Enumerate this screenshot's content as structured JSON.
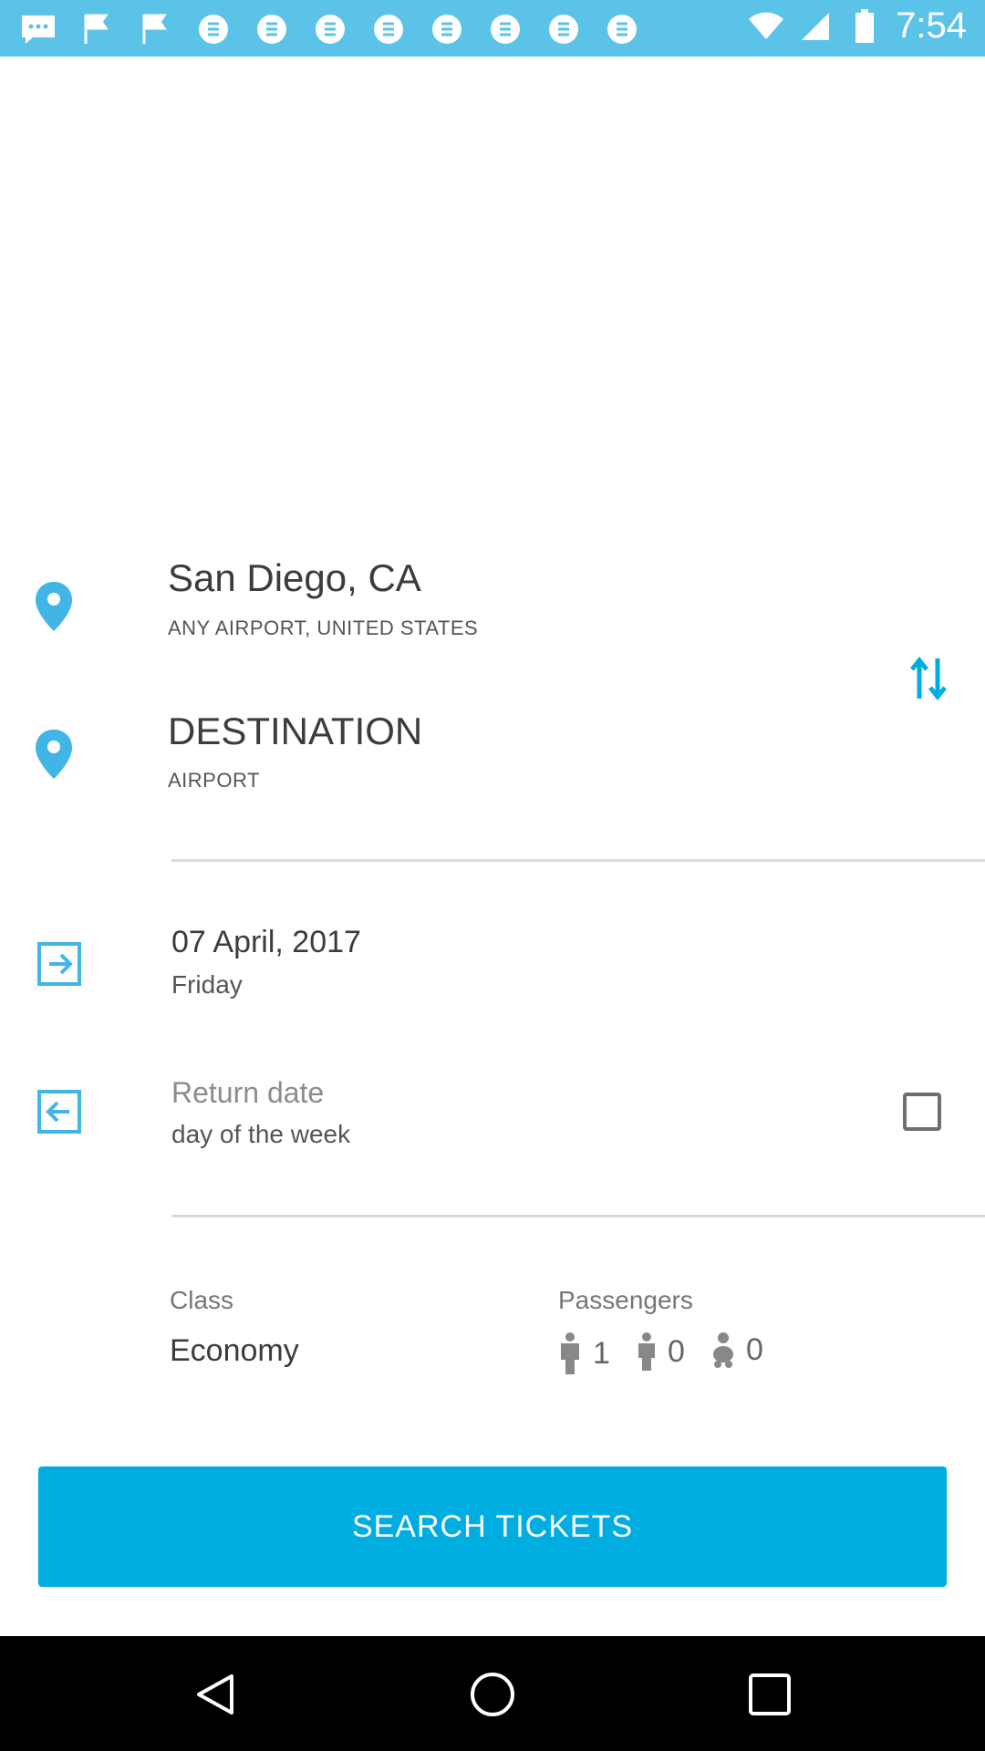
{
  "status_bar": {
    "time": "7:54"
  },
  "origin": {
    "city": "San Diego, CA",
    "airport": "ANY AIRPORT, UNITED STATES"
  },
  "destination": {
    "city": "DESTINATION",
    "airport": "AIRPORT"
  },
  "departure": {
    "date": "07 April, 2017",
    "weekday": "Friday"
  },
  "return": {
    "label": "Return date",
    "weekday": "day of the week"
  },
  "travel_class": {
    "label": "Class",
    "value": "Economy"
  },
  "passengers": {
    "label": "Passengers",
    "adults": "1",
    "children": "0",
    "infants": "0"
  },
  "search": {
    "label": "SEARCH TICKETS"
  },
  "colors": {
    "accent": "#00ade0",
    "status_bar": "#5bc3e8",
    "pin": "#41b6e6"
  }
}
